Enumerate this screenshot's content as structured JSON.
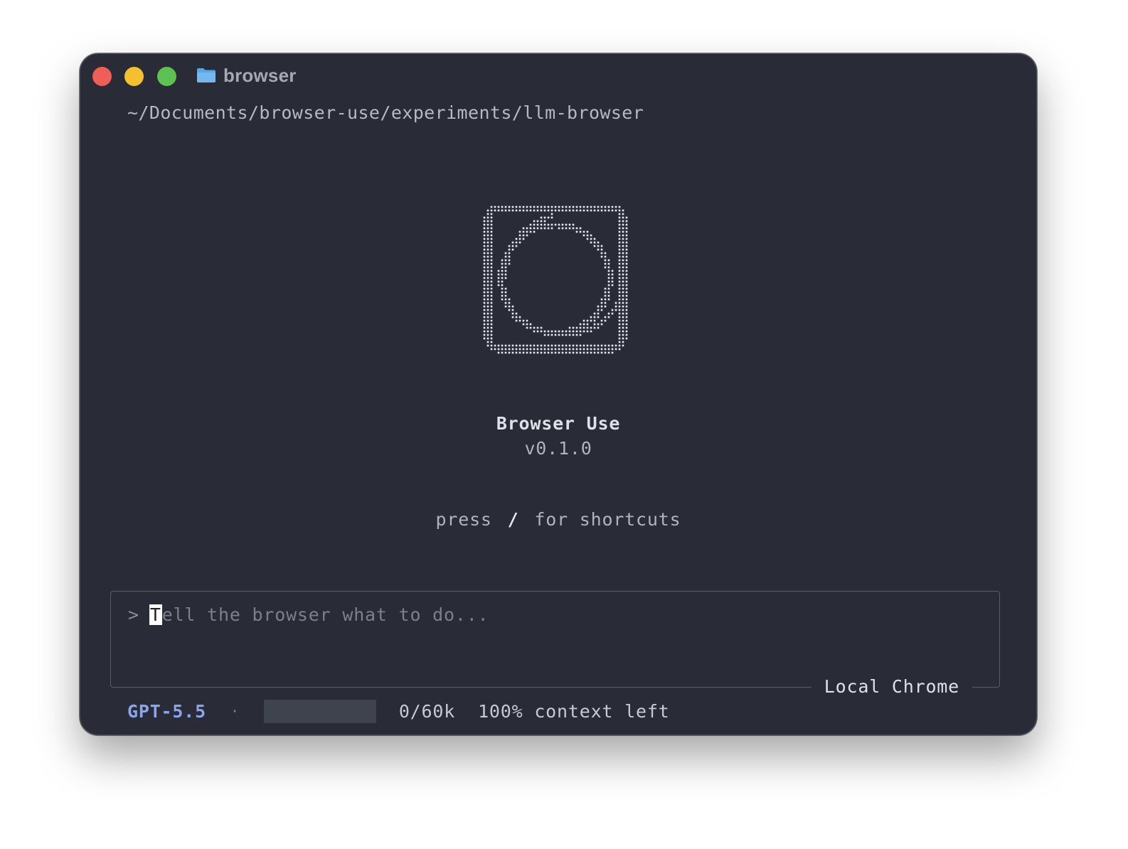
{
  "window": {
    "title": "browser",
    "path": "~/Documents/browser-use/experiments/llm-browser"
  },
  "brand": {
    "name": "Browser Use",
    "version": "v0.1.0"
  },
  "hint": {
    "prefix": "press",
    "key": "/",
    "suffix": "for shortcuts"
  },
  "input": {
    "prompt_symbol": ">",
    "placeholder_first_char": "T",
    "placeholder_rest": "ell the browser what to do...",
    "box_label": "Local Chrome"
  },
  "status": {
    "model": "GPT-5.5",
    "separator": "·",
    "context_used_fraction": 0,
    "tokens": "0/60k",
    "context_left": "100% context left"
  },
  "colors": {
    "background": "#292c36",
    "accent": "#8aa4ee",
    "traffic_red": "#ee5f57",
    "traffic_yellow": "#f4c02f",
    "traffic_green": "#5cc353",
    "folder": "#5aa6e8"
  },
  "icons": {
    "title": "folder-icon",
    "logo": "browser-use-dotted-logo-icon"
  }
}
